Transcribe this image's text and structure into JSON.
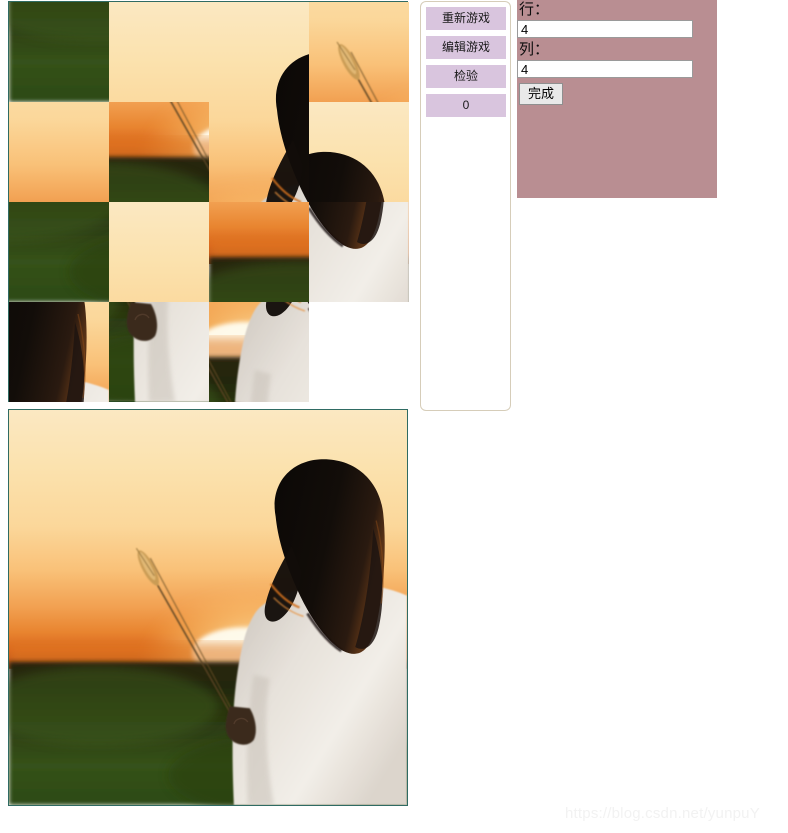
{
  "board": {
    "name": "puzzle-board",
    "rows": 4,
    "cols": 4,
    "tile_size": 100,
    "border_color": "#2f6b63",
    "empty_index": 15,
    "tiles": [
      {
        "pos": 0,
        "src_row": 3,
        "src_col": 0,
        "empty": false
      },
      {
        "pos": 1,
        "src_row": 0,
        "src_col": 1,
        "empty": false
      },
      {
        "pos": 2,
        "src_row": 0,
        "src_col": 2,
        "empty": false
      },
      {
        "pos": 3,
        "src_row": 1,
        "src_col": 1,
        "empty": false
      },
      {
        "pos": 4,
        "src_row": 1,
        "src_col": 0,
        "empty": false
      },
      {
        "pos": 5,
        "src_row": 2,
        "src_col": 1,
        "empty": false
      },
      {
        "pos": 6,
        "src_row": 1,
        "src_col": 2,
        "empty": false
      },
      {
        "pos": 7,
        "src_row": 0,
        "src_col": 3,
        "empty": false
      },
      {
        "pos": 8,
        "src_row": 3,
        "src_col": 1,
        "empty": false
      },
      {
        "pos": 9,
        "src_row": 0,
        "src_col": 0,
        "empty": false
      },
      {
        "pos": 10,
        "src_row": 2,
        "src_col": 0,
        "empty": false
      },
      {
        "pos": 11,
        "src_row": 2,
        "src_col": 3,
        "empty": false
      },
      {
        "pos": 12,
        "src_row": 1,
        "src_col": 3,
        "empty": false
      },
      {
        "pos": 13,
        "src_row": 3,
        "src_col": 2,
        "empty": false
      },
      {
        "pos": 14,
        "src_row": 2,
        "src_col": 2,
        "empty": false
      },
      {
        "pos": 15,
        "src_row": 3,
        "src_col": 3,
        "empty": true
      }
    ]
  },
  "control_panel": {
    "restart_label": "重新游戏",
    "edit_label": "编辑游戏",
    "check_label": "检验",
    "move_count": "0",
    "button_color": "#d9c5de",
    "border_color": "#d6cdb9"
  },
  "settings_panel": {
    "background_color": "#b98e92",
    "row_label": "行：",
    "row_value": "4",
    "col_label": "列：",
    "col_value": "4",
    "done_label": "完成"
  },
  "reference": {
    "name": "reference-image",
    "alt": "sunset-silhouette-photo",
    "border_color": "#2f6b63"
  },
  "watermark": {
    "text": "https://blog.csdn.net/yunpuY"
  }
}
